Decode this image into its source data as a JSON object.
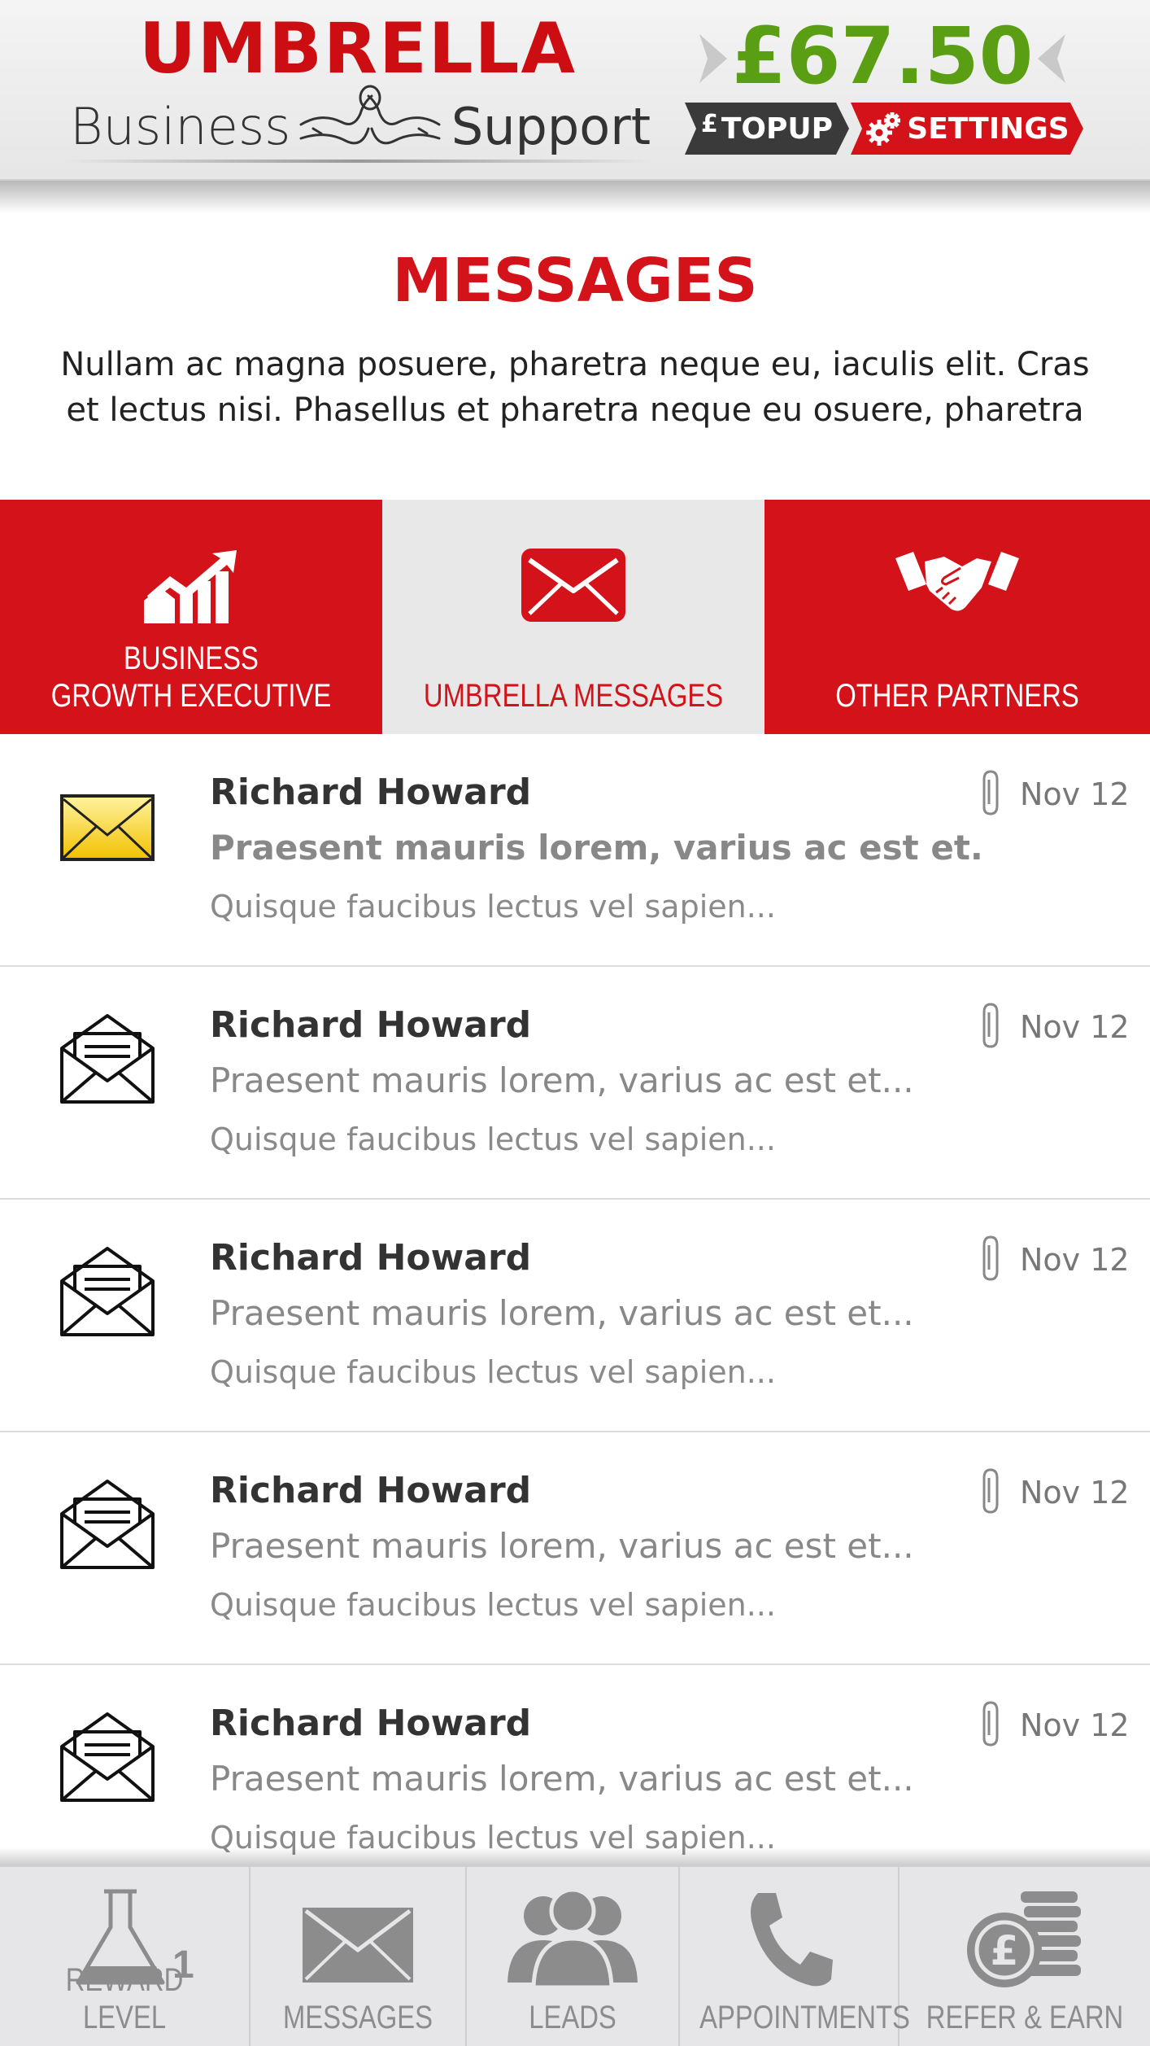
{
  "header": {
    "logo": {
      "line1": "UMBRELLA",
      "line2_left": "Business",
      "line2_right": "Support"
    },
    "balance": "£67.50",
    "topup_label": "TOPUP",
    "topup_symbol": "£",
    "settings_label": "SETTINGS",
    "colors": {
      "brand_red": "#d3121a",
      "balance_green": "#5a9e14",
      "dark": "#3a3a3a"
    }
  },
  "page": {
    "title": "MESSAGES",
    "intro": "Nullam ac magna posuere, pharetra neque eu, iaculis elit. Cras et lectus nisi. Phasellus et pharetra neque eu osuere, pharetra"
  },
  "tabs": [
    {
      "label_line1": "BUSINESS",
      "label_line2": "GROWTH EXECUTIVE",
      "icon": "growth-chart-icon",
      "active": false
    },
    {
      "label_line1": "",
      "label_line2": "UMBRELLA MESSAGES",
      "icon": "envelope-icon",
      "active": true
    },
    {
      "label_line1": "",
      "label_line2": "OTHER PARTNERS",
      "icon": "handshake-icon",
      "active": false
    }
  ],
  "messages": [
    {
      "sender": "Richard Howard",
      "subject": "Praesent mauris lorem, varius ac est et...",
      "preview": "Quisque faucibus lectus vel sapien...",
      "date": "Nov 12",
      "unread": true,
      "attachment": true,
      "icon": "closed-envelope-icon"
    },
    {
      "sender": "Richard Howard",
      "subject": "Praesent mauris lorem, varius ac est et...",
      "preview": "Quisque faucibus lectus vel sapien...",
      "date": "Nov 12",
      "unread": false,
      "attachment": true,
      "icon": "open-envelope-icon"
    },
    {
      "sender": "Richard Howard",
      "subject": "Praesent mauris lorem, varius ac est et...",
      "preview": "Quisque faucibus lectus vel sapien...",
      "date": "Nov 12",
      "unread": false,
      "attachment": true,
      "icon": "open-envelope-icon"
    },
    {
      "sender": "Richard Howard",
      "subject": "Praesent mauris lorem, varius ac est et...",
      "preview": "Quisque faucibus lectus vel sapien...",
      "date": "Nov 12",
      "unread": false,
      "attachment": true,
      "icon": "open-envelope-icon"
    },
    {
      "sender": "Richard Howard",
      "subject": "Praesent mauris lorem, varius ac est et...",
      "preview": "Quisque faucibus lectus vel sapien...",
      "date": "Nov 12",
      "unread": false,
      "attachment": true,
      "icon": "open-envelope-icon"
    }
  ],
  "bottom_nav": [
    {
      "label": "REWARD LEVEL",
      "icon": "flask-icon",
      "badge": "1"
    },
    {
      "label": "MESSAGES",
      "icon": "envelope-icon"
    },
    {
      "label": "LEADS",
      "icon": "people-icon"
    },
    {
      "label": "APPOINTMENTS",
      "icon": "phone-icon"
    },
    {
      "label": "REFER & EARN",
      "icon": "coins-icon",
      "symbol": "£"
    }
  ]
}
